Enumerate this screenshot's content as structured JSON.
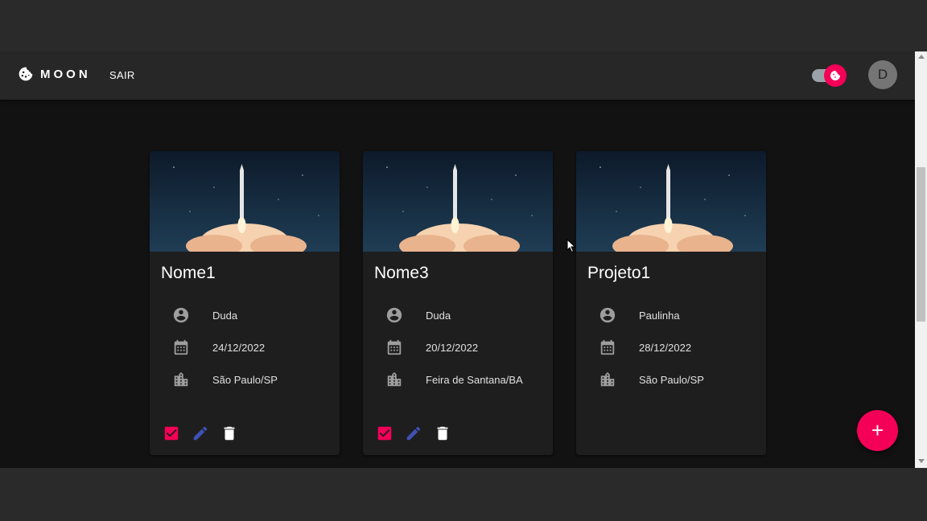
{
  "appbar": {
    "brand": "MOON",
    "logout_label": "SAIR",
    "avatar_initial": "D",
    "accent_color": "#f50057"
  },
  "projects": [
    {
      "title": "Nome1",
      "person": "Duda",
      "date": "24/12/2022",
      "location": "São Paulo/SP",
      "has_actions": true
    },
    {
      "title": "Nome3",
      "person": "Duda",
      "date": "20/12/2022",
      "location": "Feira de Santana/BA",
      "has_actions": true
    },
    {
      "title": "Projeto1",
      "person": "Paulinha",
      "date": "28/12/2022",
      "location": "São Paulo/SP",
      "has_actions": false
    }
  ],
  "icons": {
    "person": "account-circle-icon",
    "date": "calendar-icon",
    "location": "city-icon",
    "done": "checkbox-checked-icon",
    "edit": "pencil-icon",
    "delete": "trash-icon",
    "add": "plus-icon"
  },
  "fab": {
    "label": "+"
  }
}
